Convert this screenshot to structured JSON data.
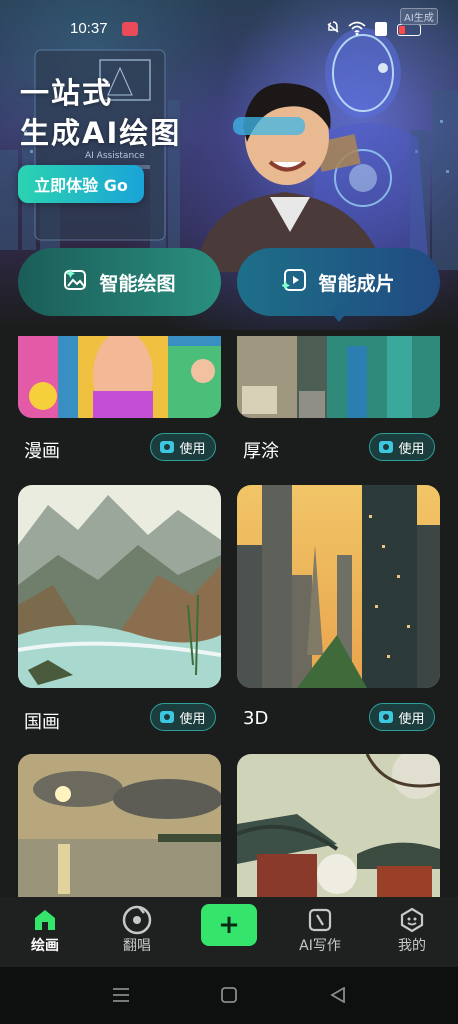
{
  "status_bar": {
    "time": "10:37",
    "badge": "AI生成"
  },
  "hero": {
    "line1": "一站式",
    "line2": "生成AI绘图",
    "cta_label": "立即体验 Go",
    "laptop_text": "AI Assistance"
  },
  "modes": [
    {
      "label": "智能绘图",
      "icon": "image-sparkle-icon",
      "selected": false
    },
    {
      "label": "智能成片",
      "icon": "video-sparkle-icon",
      "selected": true
    }
  ],
  "use_label": "使用",
  "styles": [
    {
      "name": "漫画",
      "image": "comic-art"
    },
    {
      "name": "厚涂",
      "image": "impasto-painting"
    },
    {
      "name": "国画",
      "image": "chinese-landscape-painting"
    },
    {
      "name": "3D",
      "image": "3d-city-skyline"
    },
    {
      "name": "",
      "image": "sunset-lake"
    },
    {
      "name": "",
      "image": "temple-cherry-blossom"
    }
  ],
  "tabs": [
    {
      "label": "绘画",
      "icon": "home-icon",
      "active": true
    },
    {
      "label": "翻唱",
      "icon": "music-disc-icon",
      "active": false
    },
    {
      "label": "",
      "icon": "plus-icon",
      "active": false
    },
    {
      "label": "AI写作",
      "icon": "write-icon",
      "active": false
    },
    {
      "label": "我的",
      "icon": "profile-icon",
      "active": false
    }
  ],
  "colors": {
    "accent_green": "#35e56b",
    "teal": "#2d9f97",
    "background": "#1b1d1c"
  }
}
